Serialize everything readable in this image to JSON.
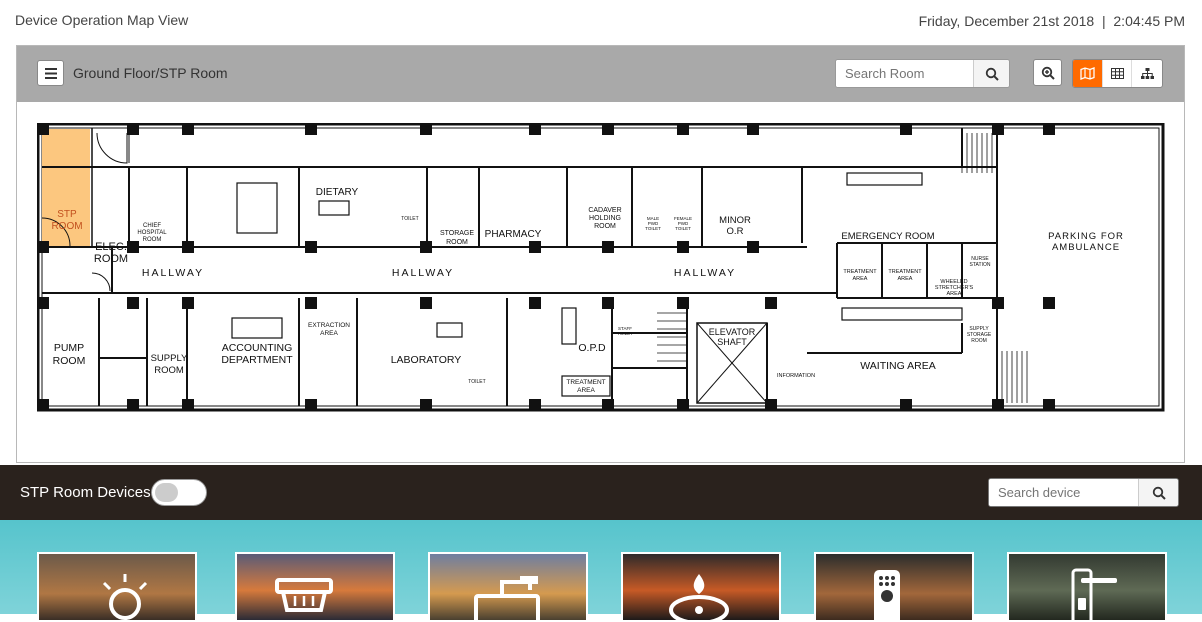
{
  "header": {
    "title": "Device Operation Map View",
    "date": "Friday, December 21st 2018",
    "separator": "|",
    "time": "2:04:45 PM"
  },
  "map_toolbar": {
    "breadcrumb": "Ground Floor/STP Room",
    "search_placeholder": "Search Room",
    "active_view": "map"
  },
  "floorplan": {
    "highlight_color": "#fcc77f",
    "rooms": {
      "stp": [
        "STP",
        "ROOM"
      ],
      "elec": [
        "ELEC.",
        "ROOM"
      ],
      "chief": [
        "CHIEF",
        "HOSPITAL",
        "ROOM"
      ],
      "dietary": "DIETARY",
      "toilet_a": "TOILET",
      "storage": [
        "STORAGE",
        "ROOM"
      ],
      "pharmacy": "PHARMACY",
      "cadaver": [
        "CADAVER",
        "HOLDING",
        "ROOM"
      ],
      "male_toilet": [
        "MALE",
        "PWD",
        "TOILET"
      ],
      "female_toilet": [
        "FEMALE",
        "PWD",
        "TOILET"
      ],
      "minor_or": [
        "MINOR",
        "O.R"
      ],
      "emergency": "EMERGENCY ROOM",
      "parking": [
        "PARKING FOR",
        "AMBULANCE"
      ],
      "hallway1": "HALLWAY",
      "hallway2": "HALLWAY",
      "hallway3": "HALLWAY",
      "treatment1": [
        "TREATMENT",
        "AREA"
      ],
      "treatment2": [
        "TREATMENT",
        "AREA"
      ],
      "wheeled": [
        "WHEELED",
        "STRETCHER'S",
        "AREA"
      ],
      "nurse": [
        "NURSE",
        "STATION"
      ],
      "pump": [
        "PUMP",
        "ROOM"
      ],
      "supply": [
        "SUPPLY",
        "ROOM"
      ],
      "accounting": [
        "ACCOUNTING",
        "DEPARTMENT"
      ],
      "extraction": [
        "EXTRACTION",
        "AREA"
      ],
      "laboratory": "LABORATORY",
      "toilet_b": "TOILET",
      "opd": "O.P.D",
      "staff_toilet": [
        "STAFF",
        "TOILET"
      ],
      "treatment3": [
        "TREATMENT",
        "AREA"
      ],
      "elevator": [
        "ELEVATOR",
        "SHAFT"
      ],
      "information": "INFORMATION",
      "waiting": "WAITING AREA",
      "supply_storage": [
        "SUPPLY",
        "STORAGE",
        "ROOM"
      ]
    }
  },
  "devices_bar": {
    "title": "STP Room Devices",
    "toggle_on": false,
    "search_placeholder": "Search device"
  },
  "device_tiles": [
    {
      "icon": "sun-icon"
    },
    {
      "icon": "heater-icon"
    },
    {
      "icon": "pump-icon"
    },
    {
      "icon": "boiler-flame-icon"
    },
    {
      "icon": "remote-icon"
    },
    {
      "icon": "door-lock-icon"
    }
  ]
}
